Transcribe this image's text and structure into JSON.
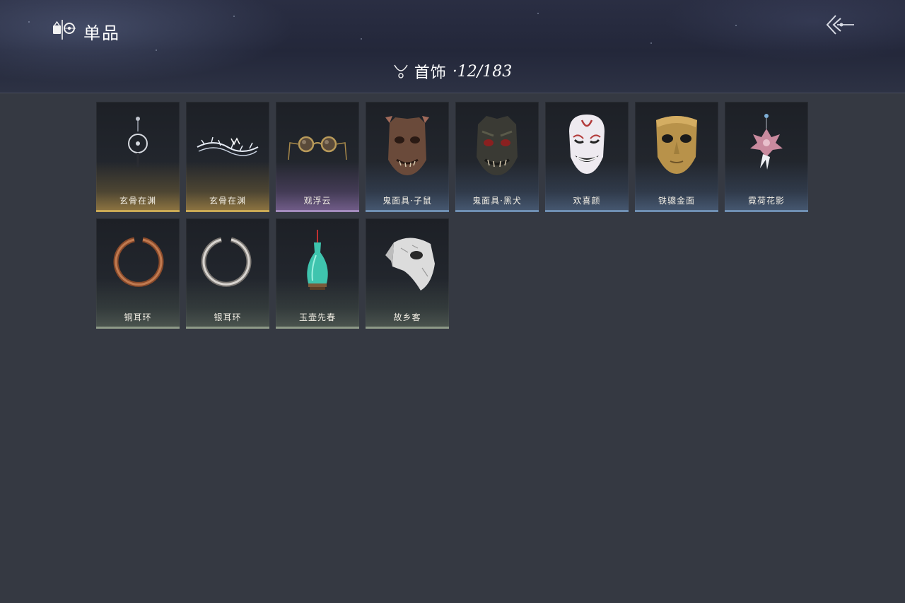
{
  "header": {
    "title": "单品",
    "logo_icon": "wardrobe-icon",
    "back_icon": "back-arrow-icon"
  },
  "category": {
    "icon": "necklace-icon",
    "name": "首饰",
    "count": "·12/183"
  },
  "items": [
    {
      "name": "玄骨在渊",
      "rarity": "gold",
      "icon": "dangle-earring-icon"
    },
    {
      "name": "玄骨在渊",
      "rarity": "gold",
      "icon": "thorn-crown-icon"
    },
    {
      "name": "观浮云",
      "rarity": "purple",
      "icon": "round-glasses-icon"
    },
    {
      "name": "鬼面具·子鼠",
      "rarity": "blue",
      "icon": "rat-demon-mask-icon"
    },
    {
      "name": "鬼面具·黑犬",
      "rarity": "blue",
      "icon": "dog-demon-mask-icon"
    },
    {
      "name": "欢喜颜",
      "rarity": "blue",
      "icon": "smiling-white-mask-icon"
    },
    {
      "name": "铁骢金面",
      "rarity": "blue",
      "icon": "gold-mask-icon"
    },
    {
      "name": "霓荷花影",
      "rarity": "blue",
      "icon": "lotus-pendant-icon"
    },
    {
      "name": "铜耳环",
      "rarity": "green",
      "icon": "copper-ring-icon"
    },
    {
      "name": "银耳环",
      "rarity": "green",
      "icon": "silver-ring-icon"
    },
    {
      "name": "玉壶先春",
      "rarity": "green",
      "icon": "jade-vase-icon"
    },
    {
      "name": "故乡客",
      "rarity": "green",
      "icon": "half-mask-icon"
    }
  ],
  "colors": {
    "background": "#353942",
    "header": "#23273a",
    "gold": "#c9a955",
    "purple": "#a38bbd",
    "blue": "#6f8fb2",
    "green": "#8e9a88"
  }
}
